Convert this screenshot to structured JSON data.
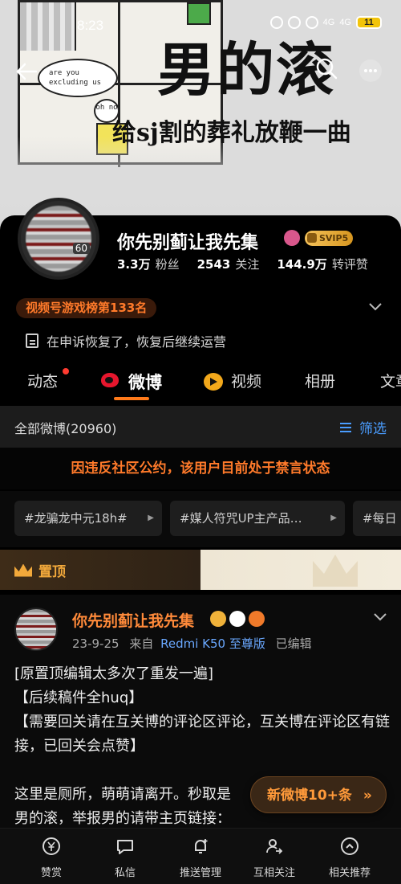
{
  "status_bar": {
    "time": "8:23",
    "network_a": "4G",
    "network_b": "4G",
    "battery": "11"
  },
  "banner": {
    "title": "男的滚",
    "subtitle": "给sj割的葬礼放鞭一曲",
    "comic_bubble_text": "are you excluding us",
    "comic_small_bubble": "oh no"
  },
  "profile": {
    "name": "你先别蓟让我先集",
    "vip_label": "SVIP5",
    "avatar_badge": "60",
    "stats": [
      {
        "value": "3.3万",
        "label": "粉丝"
      },
      {
        "value": "2543",
        "label": "关注"
      },
      {
        "value": "144.9万",
        "label": "转评赞"
      }
    ],
    "rank_pill": "视频号游戏榜第133名",
    "notice": "在申诉恢复了，恢复后继续运营"
  },
  "tabs": [
    {
      "label": "动态"
    },
    {
      "label": "微博"
    },
    {
      "label": "视频"
    },
    {
      "label": "相册"
    },
    {
      "label": "文章"
    }
  ],
  "filter": {
    "all_label": "全部微博(20960)",
    "filter_label": "筛选"
  },
  "ban_notice": "因违反社区公约，该用户目前处于禁言状态",
  "topics": [
    {
      "label": "#龙骗龙中元18h#"
    },
    {
      "label": "#媒人符咒UP主产品…"
    },
    {
      "label": "#每日"
    }
  ],
  "pinned_label": "置顶",
  "post": {
    "author": "你先别蓟让我先集",
    "date": "23-9-25",
    "from_label": "来自",
    "device": "Redmi K50 至尊版",
    "edited": "已编辑",
    "body": "[原置顶编辑太多次了重发一遍]\n【后续稿件全huq】\n【需要回关请在互关博的评论区评论，互关博在评论区有链接，已回关会点赞】\n\n这里是厕所，萌萌请离开。秒取是\n男的滚，举报男的请带主页链接："
  },
  "new_posts_pill": "新微博10+条",
  "bottom_bar": [
    {
      "label": "赞赏",
      "icon": "yen-icon"
    },
    {
      "label": "私信",
      "icon": "message-icon"
    },
    {
      "label": "推送管理",
      "icon": "bell-plus-icon"
    },
    {
      "label": "互相关注",
      "icon": "mutual-follow-icon"
    },
    {
      "label": "相关推荐",
      "icon": "recommend-icon"
    }
  ],
  "colors": {
    "accent_orange": "#ff7a2a",
    "link_blue": "#4a9dff",
    "background": "#000000"
  }
}
